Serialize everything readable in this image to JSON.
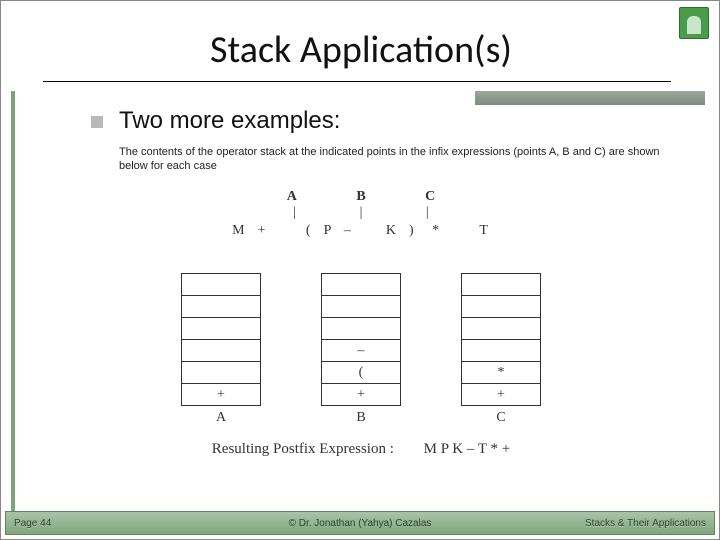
{
  "title": "Stack Application(s)",
  "heading": "Two more examples:",
  "subtext": "The contents of the operator stack at the indicated points in the infix expressions (points A, B and C) are shown below for each case",
  "expr": {
    "labels": [
      "A",
      "B",
      "C"
    ],
    "tick": "|",
    "line": "M  +       (  P  –      K  )   *       T"
  },
  "stacks": [
    {
      "label": "A",
      "cells": [
        "",
        "",
        "",
        "",
        "",
        "+"
      ]
    },
    {
      "label": "B",
      "cells": [
        "",
        "",
        "",
        "–",
        "(",
        "+"
      ]
    },
    {
      "label": "C",
      "cells": [
        "",
        "",
        "",
        "",
        "*",
        "+"
      ]
    }
  ],
  "result": {
    "label": "Resulting Postfix Expression :",
    "value": "M   P   K   –   T   *   +"
  },
  "footer": {
    "left": "Page 44",
    "mid": "© Dr. Jonathan (Yahya) Cazalas",
    "right": "Stacks & Their Applications"
  }
}
